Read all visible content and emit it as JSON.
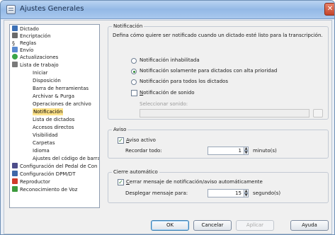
{
  "window": {
    "title": "Ajustes Generales",
    "close_icon": "close-icon"
  },
  "tree": {
    "items": [
      {
        "label": "Dictado",
        "icon": "dictation-icon",
        "level": 0
      },
      {
        "label": "Encriptación",
        "icon": "encryption-icon",
        "level": 0
      },
      {
        "label": "Reglas",
        "icon": "rules-icon",
        "level": 0
      },
      {
        "label": "Envío",
        "icon": "send-icon",
        "level": 0
      },
      {
        "label": "Actualizaciones",
        "icon": "updates-icon",
        "level": 0
      },
      {
        "label": "Lista de trabajo",
        "icon": "worklist-icon",
        "level": 0
      },
      {
        "label": "Iniciar",
        "level": 1
      },
      {
        "label": "Disposición",
        "level": 1
      },
      {
        "label": "Barra de herramientas",
        "level": 1
      },
      {
        "label": "Archivar & Purga",
        "level": 1
      },
      {
        "label": "Operaciones de archivo",
        "level": 1
      },
      {
        "label": "Notificación",
        "level": 1,
        "selected": true
      },
      {
        "label": "Lista de dictados",
        "level": 1
      },
      {
        "label": "Accesos directos",
        "level": 1
      },
      {
        "label": "Visibilidad",
        "level": 1
      },
      {
        "label": "Carpetas",
        "level": 1
      },
      {
        "label": "Idioma",
        "level": 1
      },
      {
        "label": "Ajustes del código de barras",
        "level": 1
      },
      {
        "label": "Configuración del Pedal de Con",
        "icon": "pedal-icon",
        "level": 0
      },
      {
        "label": "Configuración DPM/DT",
        "icon": "dpm-icon",
        "level": 0
      },
      {
        "label": "Reproductor",
        "icon": "player-icon",
        "level": 0
      },
      {
        "label": "Reconocimiento de Voz",
        "icon": "voice-icon",
        "level": 0
      }
    ]
  },
  "notificacion": {
    "group_title": "Notificación",
    "description": "Defina cómo quiere ser notificado cuando un dictado esté listo para la transcripción.",
    "options": [
      {
        "label": "Notificación inhabilitada",
        "checked": false
      },
      {
        "label": "Notificación solamente para dictados con alta prioridad",
        "checked": true
      },
      {
        "label": "Notificación para todos los dictados",
        "checked": false
      }
    ],
    "sound_label": "Notificación de sonido",
    "sound_checked": false,
    "select_sound_label": "Seleccionar sonido:"
  },
  "aviso": {
    "group_title": "Aviso",
    "active_label": "Aviso activo",
    "active_checked": true,
    "remind_label": "Recordar todo:",
    "remind_value": "1",
    "remind_unit": "minuto(s)"
  },
  "cierre": {
    "group_title": "Cierre automático",
    "close_label": "Cerrar mensaje de notificación/aviso automáticamente",
    "close_checked": true,
    "display_label": "Desplegar mensaje para:",
    "display_value": "15",
    "display_unit": "segundo(s)"
  },
  "buttons": {
    "ok": "OK",
    "cancel": "Cancelar",
    "apply": "Aplicar",
    "help": "Ayuda"
  }
}
